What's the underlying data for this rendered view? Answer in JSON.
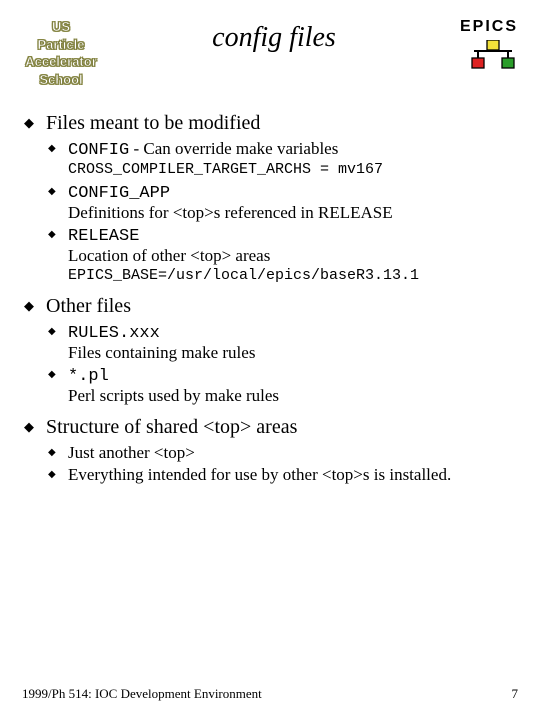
{
  "header": {
    "logo_left_line1": "US",
    "logo_left_line2": "Particle",
    "logo_left_line3": "Accelerator",
    "logo_left_line4": "School",
    "title": "config files",
    "epics_label": "EPICS"
  },
  "sections": {
    "s1": {
      "title": "Files meant to be modified",
      "items": {
        "i1": {
          "label": "CONFIG",
          "desc": " - Can override make variables",
          "code": "CROSS_COMPILER_TARGET_ARCHS = mv167"
        },
        "i2": {
          "label": "CONFIG_APP",
          "desc": "Definitions for <top>s referenced in RELEASE"
        },
        "i3": {
          "label": "RELEASE",
          "desc": "Location of other <top> areas",
          "code": "EPICS_BASE=/usr/local/epics/baseR3.13.1"
        }
      }
    },
    "s2": {
      "title": "Other files",
      "items": {
        "i1": {
          "label": "RULES.xxx",
          "desc": "Files containing make rules"
        },
        "i2": {
          "label": "*.pl",
          "desc": "Perl scripts used by make rules"
        }
      }
    },
    "s3": {
      "title": "Structure of shared <top> areas",
      "items": {
        "i1": {
          "text": "Just another <top>"
        },
        "i2": {
          "text": "Everything intended for use by other <top>s is installed."
        }
      }
    }
  },
  "footer": {
    "left": "1999/Ph 514: IOC Development Environment",
    "right": "7"
  }
}
